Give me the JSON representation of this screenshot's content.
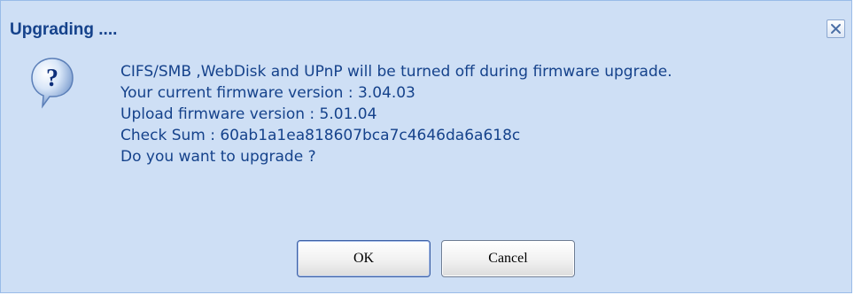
{
  "dialog": {
    "title": "Upgrading ....",
    "close_icon": "close-icon",
    "message_icon": "question-icon",
    "message_lines": [
      "CIFS/SMB ,WebDisk and UPnP will be turned off during firmware upgrade.",
      "Your current firmware version : 3.04.03",
      "Upload firmware version : 5.01.04",
      "Check Sum : 60ab1a1ea818607bca7c4646da6a618c",
      "Do you want to upgrade ?"
    ],
    "buttons": {
      "ok_label": "OK",
      "cancel_label": "Cancel"
    }
  },
  "colors": {
    "body_bg": "#cedff5",
    "title_text": "#15428b",
    "border": "#99bbe8"
  }
}
